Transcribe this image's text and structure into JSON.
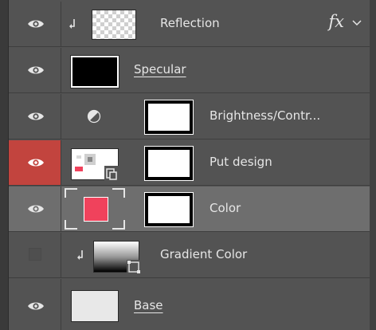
{
  "colors": {
    "panel_bg": "#535353",
    "selected_bg": "#6e6e6e",
    "visibility_highlight": "#c2443e",
    "swatch": "#f0425c",
    "text": "#e6e6e6"
  },
  "layers": [
    {
      "name": "Reflection",
      "visible": true,
      "clipped": true,
      "thumbnail": "checkerboard",
      "fx": "fx"
    },
    {
      "name": "Specular",
      "visible": true,
      "thumbnail": "black-fill"
    },
    {
      "name": "Brightness/Contr...",
      "visible": true,
      "thumbnail": "adjustment-brightness-contrast",
      "mask": true
    },
    {
      "name": "Put design",
      "visible": true,
      "thumbnail": "smart-object",
      "mask": true,
      "visibility_highlight": true
    },
    {
      "name": "Color",
      "visible": true,
      "selected": true,
      "thumbnail": "color-fill",
      "mask": true
    },
    {
      "name": "Gradient Color",
      "visible": false,
      "clipped": true,
      "thumbnail": "gradient-smart-object"
    },
    {
      "name": "Base",
      "visible": true,
      "thumbnail": "light-gray"
    }
  ],
  "icons": {
    "visibility": "eye-icon",
    "clip": "clipping-arrow-icon",
    "adjustment": "half-circle-adjustment-icon",
    "smart_object": "smart-object-badge-icon",
    "options": "chevron-down-icon"
  }
}
